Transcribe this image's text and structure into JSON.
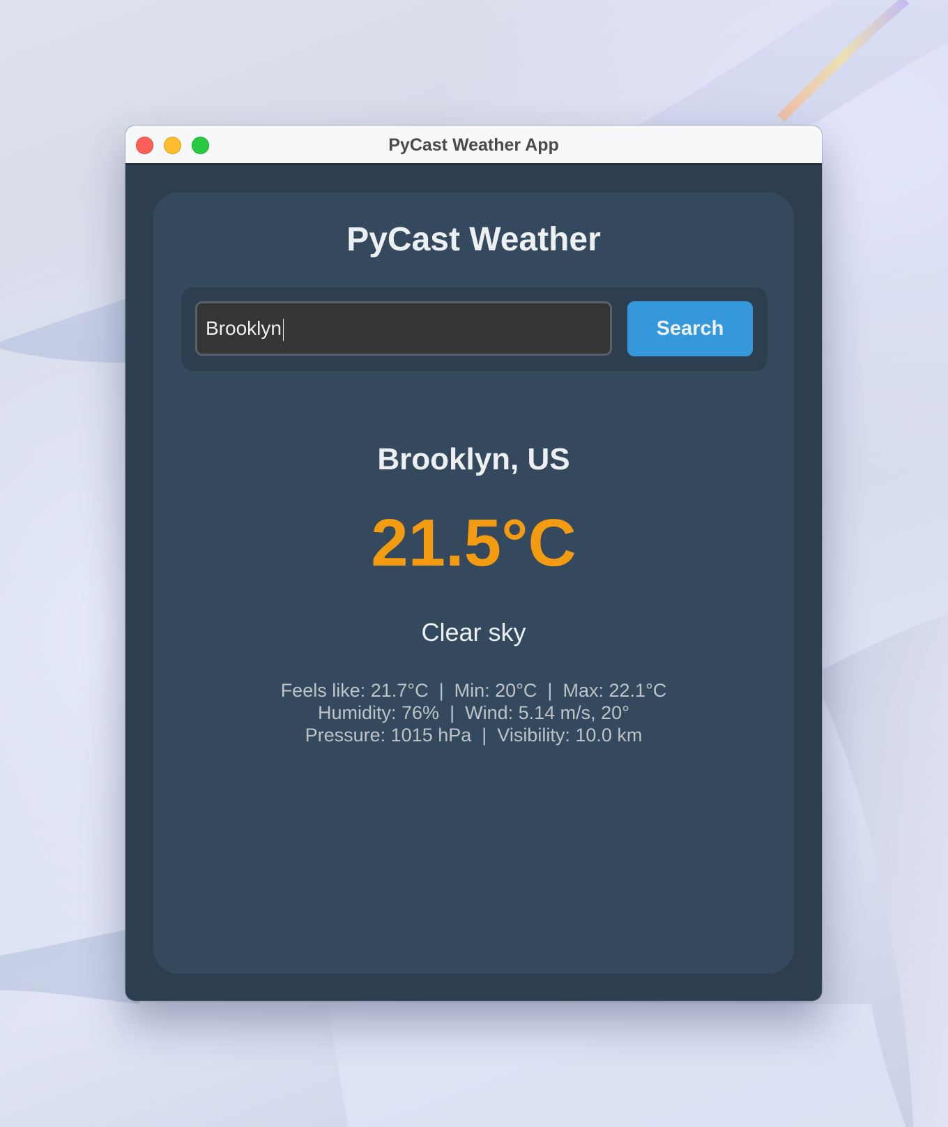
{
  "window": {
    "title": "PyCast Weather App"
  },
  "app": {
    "title": "PyCast Weather"
  },
  "search": {
    "value": "Brooklyn",
    "button_label": "Search"
  },
  "weather": {
    "city": "Brooklyn, US",
    "temperature": "21.5°C",
    "description": "Clear sky",
    "details": [
      "Feels like: 21.7°C  |  Min: 20°C  |  Max: 22.1°C",
      "Humidity: 76%  |  Wind: 5.14 m/s, 20°",
      "Pressure: 1015 hPa  |  Visibility: 10.0 km"
    ]
  },
  "colors": {
    "window_background": "#2c3e50",
    "card_background": "#34495e",
    "accent_button": "#3498db",
    "temperature": "#f39c12",
    "primary_text": "#ecf0f1",
    "secondary_text": "#bdc3c7"
  },
  "icons": {
    "close": "close-icon",
    "minimize": "minimize-icon",
    "maximize": "maximize-icon"
  }
}
